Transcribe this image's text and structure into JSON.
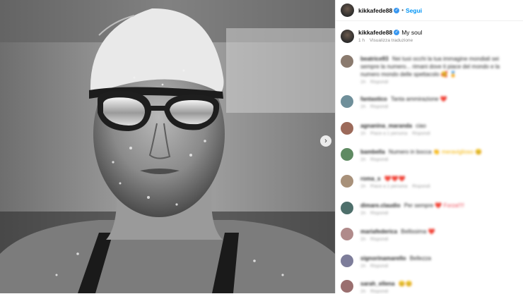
{
  "post": {
    "author": "kikkafede88",
    "follow_label": "Segui",
    "separator": "•",
    "verified_glyph": "✓",
    "caption": {
      "username": "kikkafede88",
      "text": "My soul",
      "time": "1 h",
      "translate_label": "Visualizza traduzione"
    },
    "media": {
      "type": "black-and-white photo",
      "next_icon": "›"
    }
  },
  "comments": [
    {
      "username": "beatrice93",
      "text": "Nei tuoi occhi la tua immagine mondiali sei sempre la numero... rimani dove ti piace del mondo e la numero mondo delle spettacolo",
      "emoji": "🥰 🏅",
      "meta": [
        "1h",
        "Rispondi"
      ]
    },
    {
      "username": "fantastico",
      "text": "Tanta ammirazione",
      "emoji": "❤️",
      "meta": [
        "1h",
        "Rispondi"
      ]
    },
    {
      "username": "agnanina_maranda",
      "text": "ciao",
      "emoji": "",
      "meta": [
        "1h",
        "Piace a 1 persona",
        "Rispondi"
      ]
    },
    {
      "username": "bambella",
      "text": "Numero in bocca",
      "emoji": "👏 meraviglioso 😊",
      "meta": [
        "1h",
        "Rispondi"
      ]
    },
    {
      "username": "roma_s",
      "text": "",
      "emoji": "❤️❤️❤️",
      "meta": [
        "1h",
        "Piace a 1 persona",
        "Rispondi"
      ]
    },
    {
      "username": "dimare.claudio",
      "text": "Per sempre",
      "emoji": "❤️ Forza!!!!",
      "meta": [
        "1h",
        "Rispondi"
      ]
    },
    {
      "username": "mariafederica",
      "text": "Bellissima",
      "emoji": "❤️",
      "meta": [
        "1h",
        "Rispondi"
      ]
    },
    {
      "username": "signorinamarello",
      "text": "Bellezza",
      "emoji": "",
      "meta": [
        "1h",
        "Rispondi"
      ]
    },
    {
      "username": "sarah_ellena",
      "text": "",
      "emoji": "😊😊",
      "meta": [
        "1h",
        "Rispondi"
      ]
    }
  ],
  "colors": {
    "accent": "#0095f6",
    "verified": "#3897f0",
    "meta": "#8e8e8e"
  }
}
